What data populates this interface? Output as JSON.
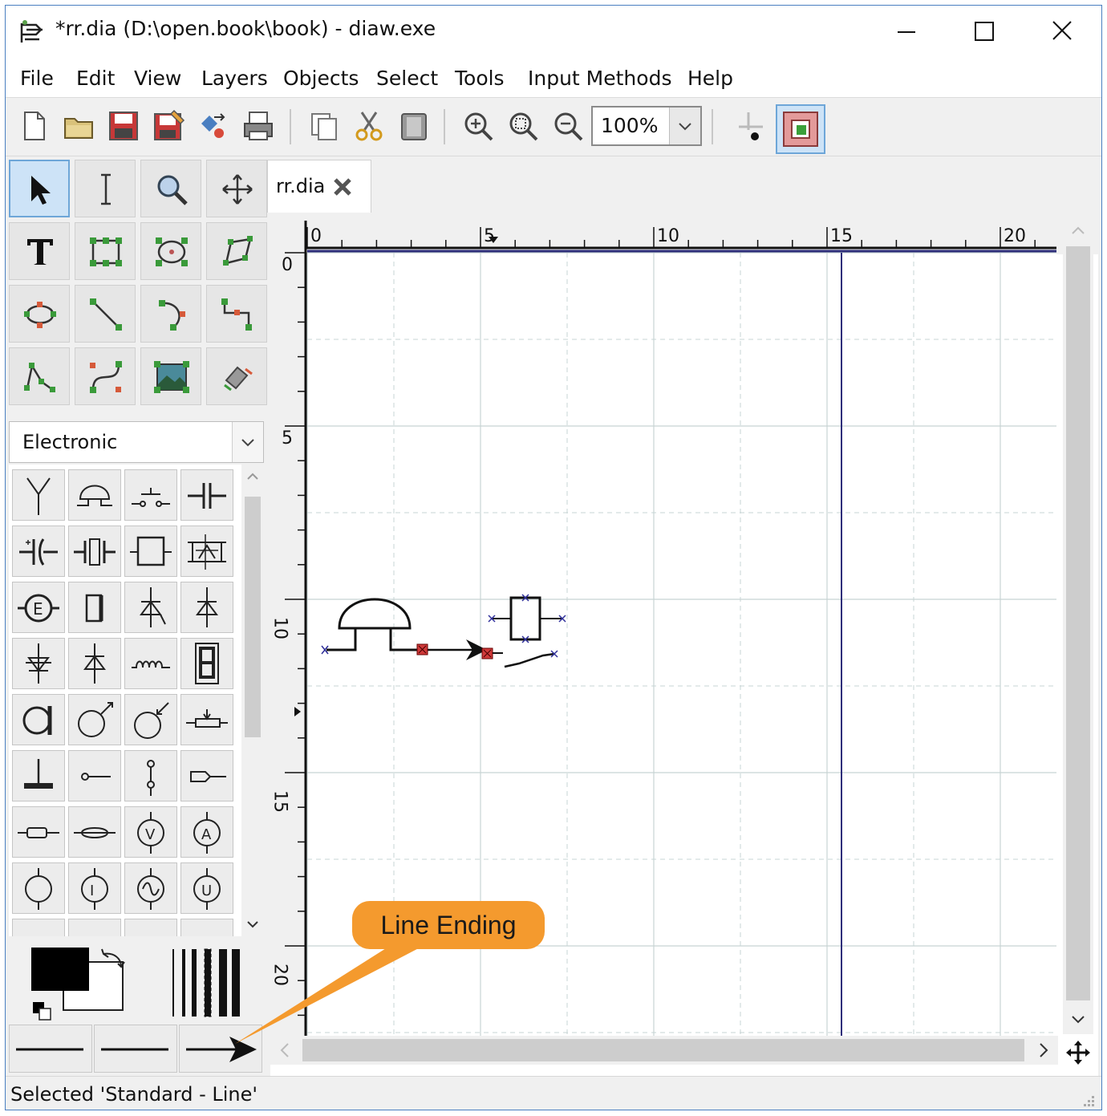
{
  "window": {
    "title": "*rr.dia (D:\\open.book\\book) - diaw.exe",
    "controls": [
      "minimize",
      "maximize",
      "close"
    ]
  },
  "menu": [
    "File",
    "Edit",
    "View",
    "Layers",
    "Objects",
    "Select",
    "Tools",
    "Input Methods",
    "Help"
  ],
  "toolbar": {
    "buttons": [
      "new-file-icon",
      "open-folder-icon",
      "save-icon",
      "save-as-icon",
      "export-icon",
      "print-icon",
      "copy-icon",
      "cut-icon",
      "paste-icon",
      "zoom-in-icon",
      "zoom-fit-icon",
      "zoom-out-icon"
    ],
    "zoom_value": "100%",
    "snap_to_grid": "snap-grid-icon",
    "object_snap": "object-snap-icon"
  },
  "tools": [
    "pointer-tool",
    "text-edit-tool",
    "magnify-tool",
    "scroll-tool",
    "text-tool",
    "box-tool",
    "ellipse-tool",
    "polygon-tool",
    "beziergon-tool",
    "line-tool",
    "arc-tool",
    "zigzagline-tool",
    "polyline-tool",
    "bezierline-tool",
    "image-tool",
    "outline-tool"
  ],
  "sheet": {
    "selected": "Electronic"
  },
  "document_tab": {
    "label": "rr.dia"
  },
  "rulers": {
    "horizontal_labels": [
      "0",
      "5",
      "10",
      "15",
      "20"
    ],
    "vertical_labels": [
      "0",
      "5",
      "10",
      "15",
      "20"
    ]
  },
  "callout": {
    "label": "Line Ending",
    "color": "#f49a2e"
  },
  "status": {
    "text": "Selected 'Standard - Line'"
  },
  "colors": {
    "foreground": "#000000",
    "background": "#ffffff",
    "grid_line": "#c7d4d4",
    "page_border": "#2e2e7a",
    "accent": "#4a7fc1"
  }
}
